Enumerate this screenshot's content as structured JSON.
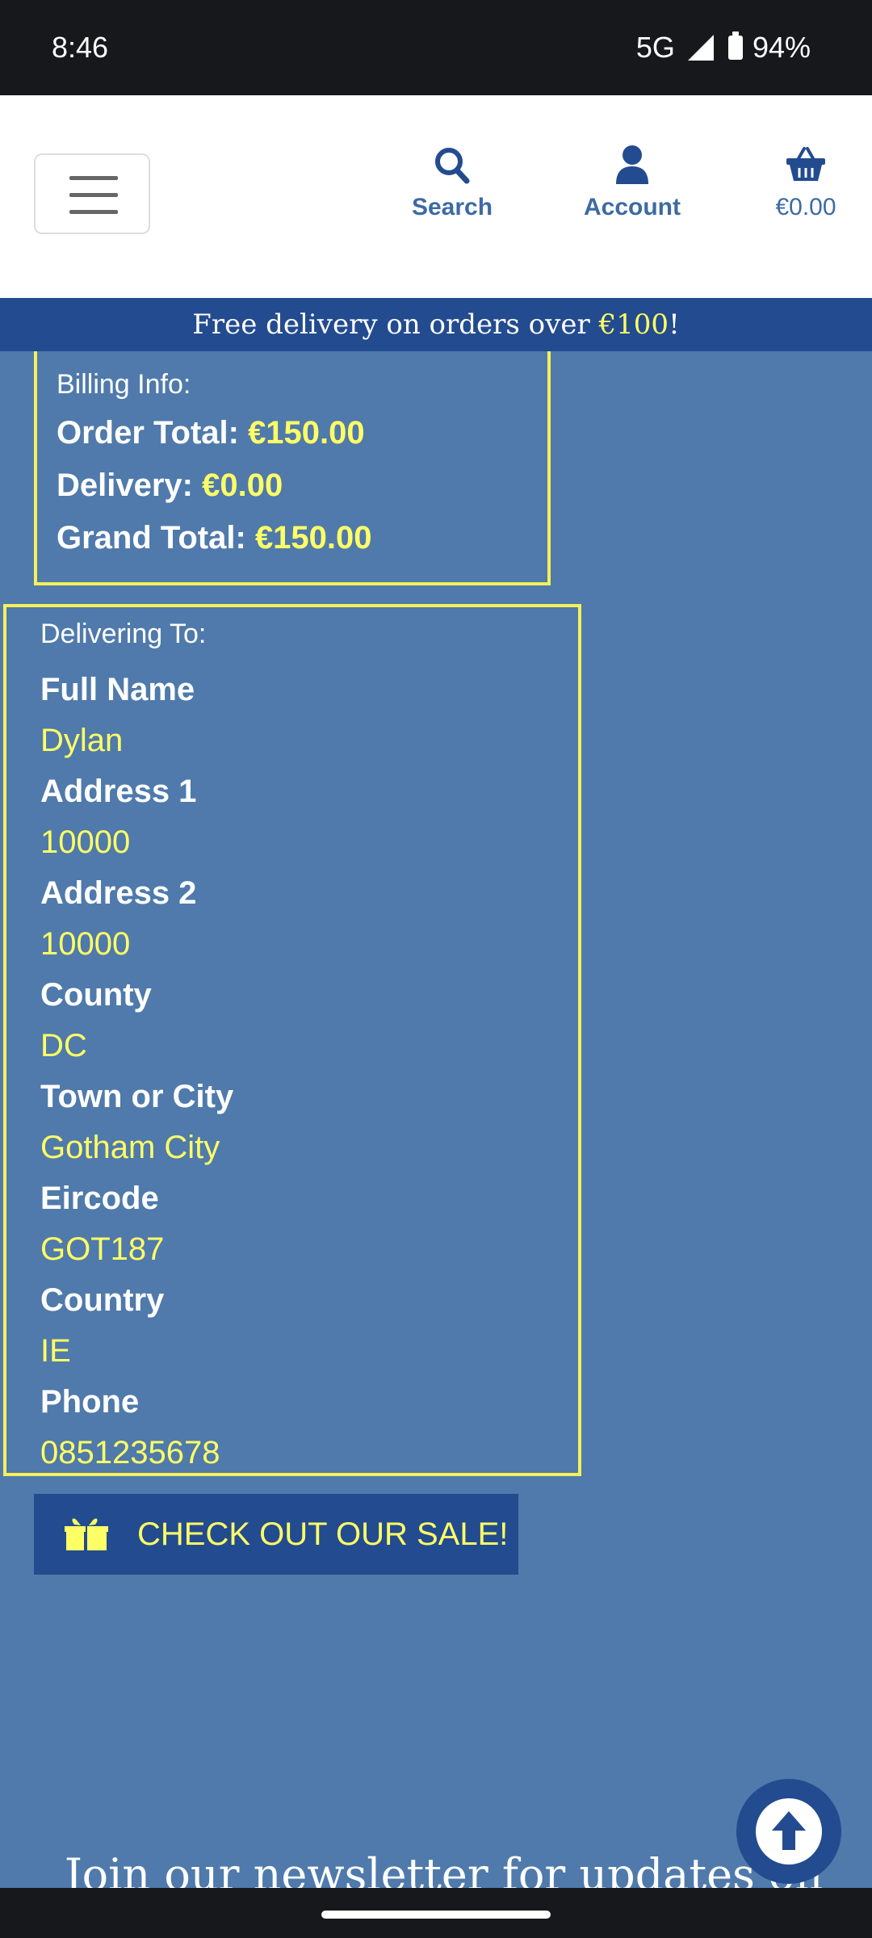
{
  "status_bar": {
    "time": "8:46",
    "network": "5G",
    "battery": "94%"
  },
  "header": {
    "menu_icon": "hamburger-icon",
    "search": {
      "label": "Search",
      "icon": "search-icon"
    },
    "account": {
      "label": "Account",
      "icon": "user-icon"
    },
    "cart": {
      "label": "€0.00",
      "icon": "basket-icon"
    }
  },
  "banner": {
    "prefix": "Free delivery on orders over ",
    "amount": "€100",
    "suffix": "!"
  },
  "billing": {
    "heading": "Billing Info:",
    "order_total_label": "Order Total:",
    "order_total_value": "€150.00",
    "delivery_label": "Delivery:",
    "delivery_value": "€0.00",
    "grand_total_label": "Grand Total:",
    "grand_total_value": "€150.00"
  },
  "delivery": {
    "heading": "Delivering To:",
    "fields": [
      {
        "label": "Full Name",
        "value": "Dylan"
      },
      {
        "label": "Address 1",
        "value": "10000"
      },
      {
        "label": "Address 2",
        "value": "10000"
      },
      {
        "label": "County",
        "value": "DC"
      },
      {
        "label": "Town or City",
        "value": "Gotham City"
      },
      {
        "label": "Eircode",
        "value": "GOT187"
      },
      {
        "label": "Country",
        "value": "IE"
      },
      {
        "label": "Phone",
        "value": "0851235678"
      }
    ]
  },
  "sale_button": {
    "label": "CHECK OUT OUR SALE!",
    "icon": "gift-icon"
  },
  "newsletter": {
    "text": "Join our newsletter for updates on"
  },
  "scroll_top": {
    "icon": "arrow-up-circle-icon"
  },
  "colors": {
    "background": "#4f7aab",
    "navy": "#234b8f",
    "highlight": "#ffff66",
    "border": "#f6f05a"
  }
}
